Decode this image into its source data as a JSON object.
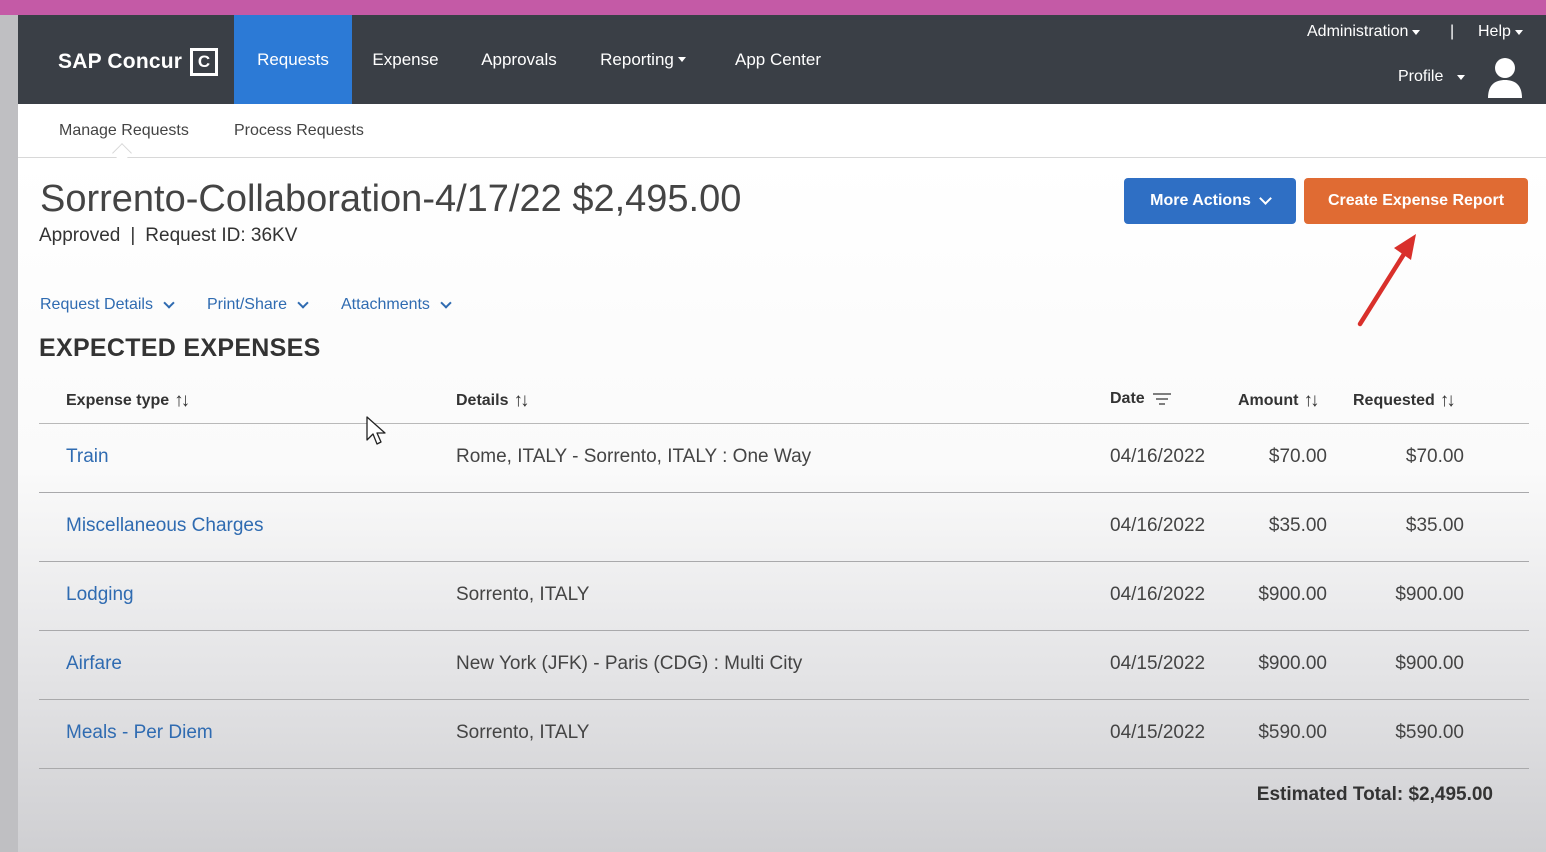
{
  "app": {
    "brand": "SAP Concur",
    "brand_mark": "C"
  },
  "nav": {
    "tabs": [
      {
        "label": "Requests",
        "active": true
      },
      {
        "label": "Expense"
      },
      {
        "label": "Approvals"
      },
      {
        "label": "Reporting"
      },
      {
        "label": "App Center"
      }
    ],
    "administration": "Administration",
    "divider": "|",
    "help": "Help",
    "profile": "Profile"
  },
  "subnav": {
    "items": [
      "Manage Requests",
      "Process Requests"
    ]
  },
  "request": {
    "title": "Sorrento-Collaboration-4/17/22 $2,495.00",
    "status": "Approved",
    "separator": "|",
    "request_id": "Request ID: 36KV"
  },
  "actions": {
    "more_actions": "More Actions",
    "create_report": "Create Expense Report"
  },
  "section_links": [
    "Request Details",
    "Print/Share",
    "Attachments"
  ],
  "expenses": {
    "heading": "EXPECTED EXPENSES",
    "columns": {
      "type": "Expense type",
      "details": "Details",
      "date": "Date",
      "amount": "Amount",
      "requested": "Requested"
    },
    "rows": [
      {
        "type": "Train",
        "details": "Rome, ITALY - Sorrento, ITALY : One Way",
        "date": "04/16/2022",
        "amount": "$70.00",
        "requested": "$70.00"
      },
      {
        "type": "Miscellaneous Charges",
        "details": "",
        "date": "04/16/2022",
        "amount": "$35.00",
        "requested": "$35.00"
      },
      {
        "type": "Lodging",
        "details": "Sorrento, ITALY",
        "date": "04/16/2022",
        "amount": "$900.00",
        "requested": "$900.00"
      },
      {
        "type": "Airfare",
        "details": "New York (JFK) - Paris (CDG) : Multi City",
        "date": "04/15/2022",
        "amount": "$900.00",
        "requested": "$900.00"
      },
      {
        "type": "Meals - Per Diem",
        "details": "Sorrento, ITALY",
        "date": "04/15/2022",
        "amount": "$590.00",
        "requested": "$590.00"
      }
    ],
    "total": "Estimated Total: $2,495.00"
  },
  "colors": {
    "nav_bg": "#3a3f46",
    "nav_active": "#2c7ad6",
    "link": "#2f6bb1",
    "primary_button": "#2f6fc4",
    "accent_button": "#e06b33",
    "annotation_arrow": "#d9302b"
  },
  "icons": {
    "sort": "sort-arrows-icon",
    "filter": "filter-lines-icon",
    "chevron": "chevron-down-icon",
    "avatar": "user-avatar-icon",
    "annotation": "red-arrow-icon",
    "cursor": "mouse-cursor-icon"
  }
}
